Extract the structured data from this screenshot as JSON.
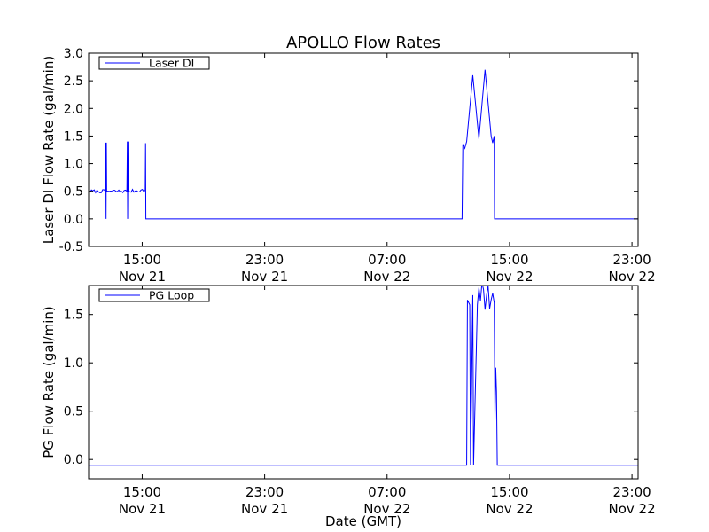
{
  "figure_title": "APOLLO Flow Rates",
  "xlabel": "Date (GMT)",
  "time_ticks": [
    {
      "hours": 15,
      "time": "15:00",
      "date": "Nov 21"
    },
    {
      "hours": 23,
      "time": "23:00",
      "date": "Nov 21"
    },
    {
      "hours": 31,
      "time": "07:00",
      "date": "Nov 22"
    },
    {
      "hours": 39,
      "time": "15:00",
      "date": "Nov 22"
    },
    {
      "hours": 47,
      "time": "23:00",
      "date": "Nov 22"
    }
  ],
  "chart_data": [
    {
      "type": "line",
      "title": "APOLLO Flow Rates",
      "ylabel": "Laser DI Flow Rate (gal/min)",
      "xlabel": "",
      "xlim_hours": [
        11.5,
        47.4
      ],
      "ylim": [
        -0.5,
        3.0
      ],
      "yticks": [
        -0.5,
        0.0,
        0.5,
        1.0,
        1.5,
        2.0,
        2.5,
        3.0
      ],
      "ytick_labels": [
        "-0.5",
        "0.0",
        "0.5",
        "1.0",
        "1.5",
        "2.0",
        "2.5",
        "3.0"
      ],
      "legend_position": "top-left",
      "color": "#0000ff",
      "series": [
        {
          "name": "Laser DI",
          "hours": [
            11.5,
            12.6,
            12.62,
            12.64,
            12.66,
            12.68,
            14.0,
            14.03,
            14.05,
            14.07,
            14.09,
            15.2,
            15.22,
            15.24,
            15.26,
            15.28,
            35.9,
            35.95,
            36.2,
            36.6,
            37.0,
            37.4,
            37.8,
            38.0,
            38.02,
            47.4
          ],
          "values": [
            0.5,
            0.5,
            1.38,
            0.0,
            1.38,
            0.5,
            0.5,
            1.4,
            0.0,
            1.4,
            0.5,
            0.52,
            1.37,
            0.0,
            0.0,
            0.0,
            0.0,
            1.35,
            1.4,
            2.6,
            1.45,
            2.7,
            1.5,
            1.5,
            0.0,
            0.0
          ]
        }
      ]
    },
    {
      "type": "line",
      "title": "",
      "ylabel": "PG Flow Rate (gal/min)",
      "xlabel": "Date (GMT)",
      "xlim_hours": [
        11.5,
        47.4
      ],
      "ylim": [
        -0.2,
        1.8
      ],
      "yticks": [
        0.0,
        0.5,
        1.0,
        1.5
      ],
      "ytick_labels": [
        "0.0",
        "0.5",
        "1.0",
        "1.5"
      ],
      "legend_position": "top-left",
      "color": "#0000ff",
      "series": [
        {
          "name": "PG Loop",
          "hours": [
            11.5,
            36.2,
            36.25,
            36.4,
            36.45,
            36.6,
            36.65,
            36.9,
            37.5,
            38.0,
            38.05,
            38.1,
            38.15,
            38.2,
            47.4
          ],
          "values": [
            -0.06,
            -0.06,
            1.65,
            1.6,
            -0.06,
            1.7,
            -0.06,
            1.6,
            1.7,
            1.62,
            0.4,
            0.95,
            0.7,
            -0.06,
            -0.06
          ]
        }
      ]
    }
  ]
}
